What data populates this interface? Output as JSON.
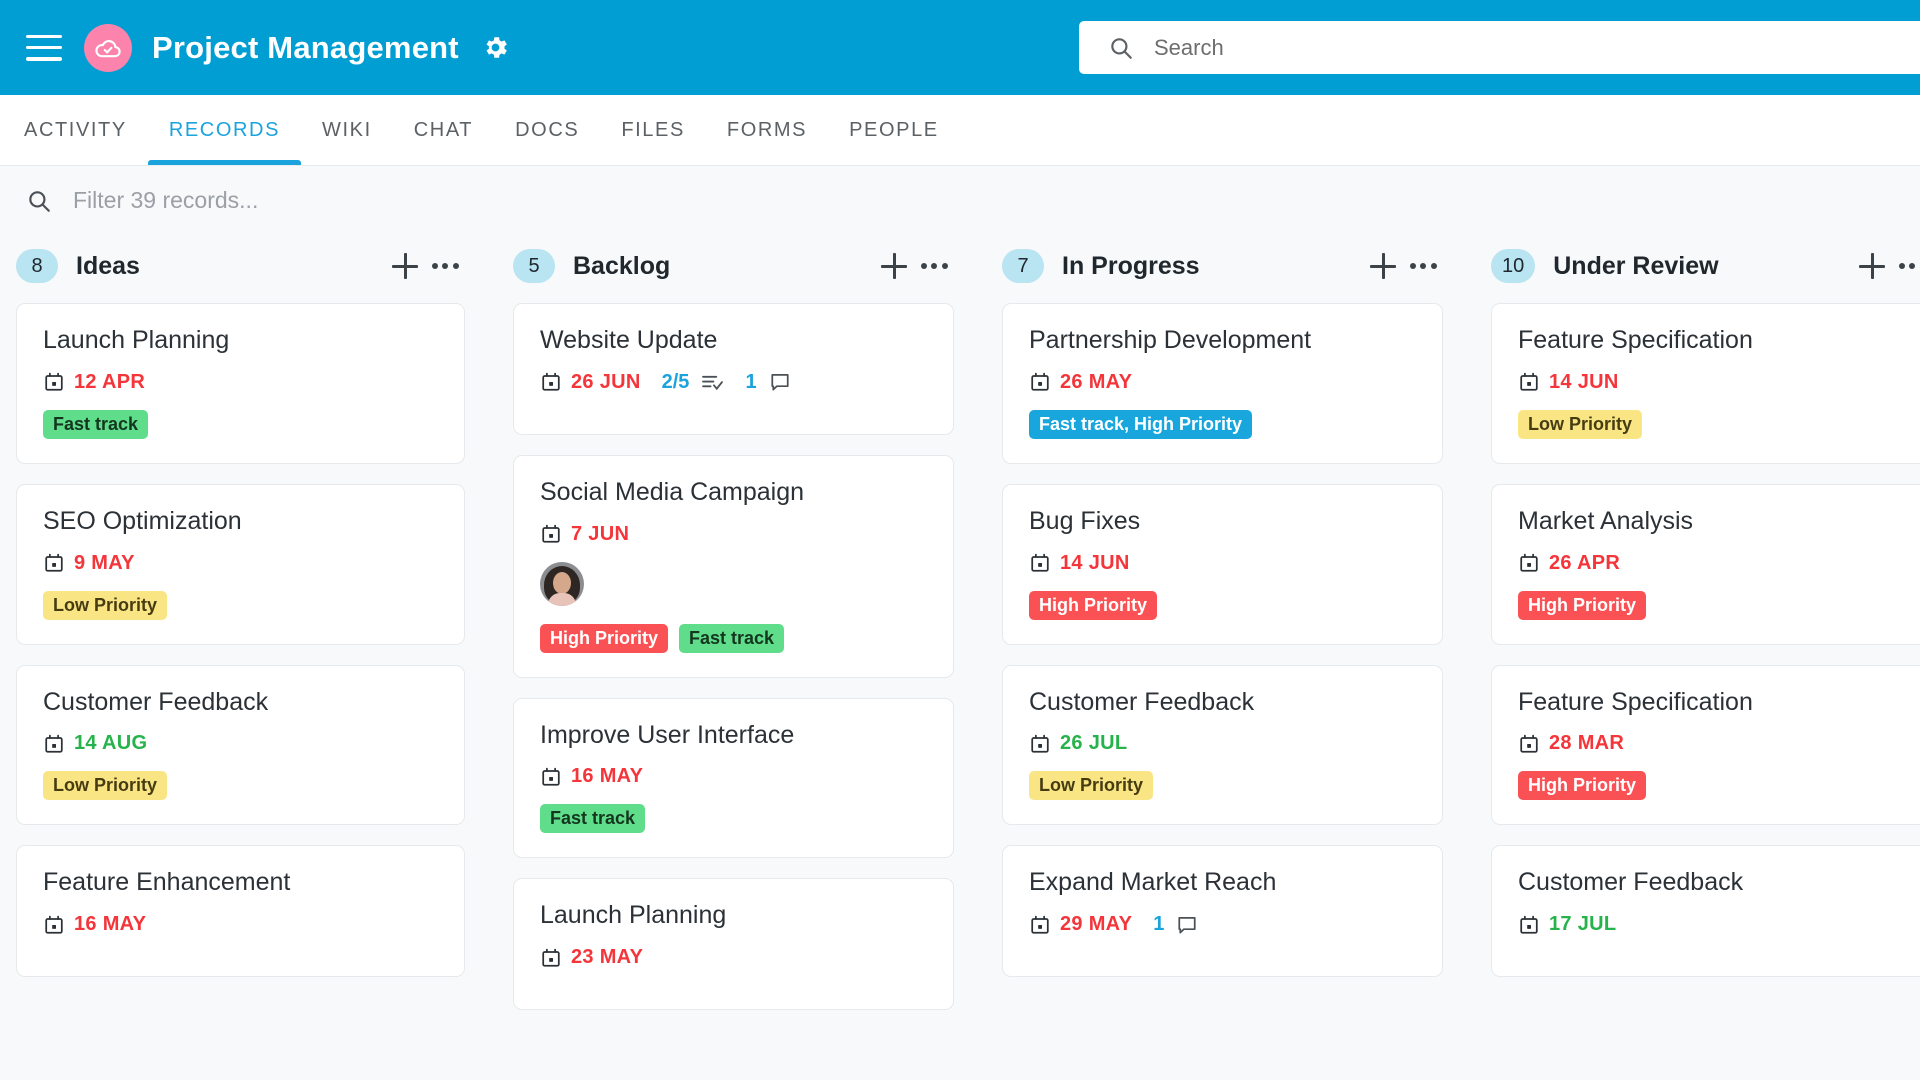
{
  "header": {
    "menu_icon": "hamburger-icon",
    "logo_icon": "cloud-check-icon",
    "title": "Project Management",
    "settings_icon": "gear-icon",
    "search": {
      "icon": "search-icon",
      "value": "",
      "placeholder": "Search"
    },
    "bar_color": "#009ed2",
    "logo_color": "#fb83ac"
  },
  "tabs": [
    {
      "label": "ACTIVITY",
      "active": false
    },
    {
      "label": "RECORDS",
      "active": true
    },
    {
      "label": "WIKI",
      "active": false
    },
    {
      "label": "CHAT",
      "active": false
    },
    {
      "label": "DOCS",
      "active": false
    },
    {
      "label": "FILES",
      "active": false
    },
    {
      "label": "FORMS",
      "active": false
    },
    {
      "label": "PEOPLE",
      "active": false
    }
  ],
  "filter": {
    "icon": "search-icon",
    "value": "",
    "placeholder": "Filter 39 records..."
  },
  "board": {
    "add_icon": "plus-icon",
    "more_icon": "more-options-icon",
    "columns": [
      {
        "count": "8",
        "title": "Ideas",
        "cards": [
          {
            "title": "Launch Planning",
            "due": "12 APR",
            "due_color": "red",
            "checklist": "",
            "comments": "",
            "avatar": false,
            "tags": [
              {
                "label": "Fast track",
                "color": "green"
              }
            ]
          },
          {
            "title": "SEO Optimization",
            "due": "9 MAY",
            "due_color": "red",
            "checklist": "",
            "comments": "",
            "avatar": false,
            "tags": [
              {
                "label": "Low Priority",
                "color": "yellow"
              }
            ]
          },
          {
            "title": "Customer Feedback",
            "due": "14 AUG",
            "due_color": "green",
            "checklist": "",
            "comments": "",
            "avatar": false,
            "tags": [
              {
                "label": "Low Priority",
                "color": "yellow"
              }
            ]
          },
          {
            "title": "Feature Enhancement",
            "due": "16 MAY",
            "due_color": "red",
            "checklist": "",
            "comments": "",
            "avatar": false,
            "tags": []
          }
        ]
      },
      {
        "count": "5",
        "title": "Backlog",
        "cards": [
          {
            "title": "Website Update",
            "due": "26 JUN",
            "due_color": "red",
            "checklist": "2/5",
            "comments": "1",
            "avatar": false,
            "tags": []
          },
          {
            "title": "Social Media Campaign",
            "due": "7 JUN",
            "due_color": "red",
            "checklist": "",
            "comments": "",
            "avatar": true,
            "tags": [
              {
                "label": "High Priority",
                "color": "red"
              },
              {
                "label": "Fast track",
                "color": "green"
              }
            ]
          },
          {
            "title": "Improve User Interface",
            "due": "16 MAY",
            "due_color": "red",
            "checklist": "",
            "comments": "",
            "avatar": false,
            "tags": [
              {
                "label": "Fast track",
                "color": "green"
              }
            ]
          },
          {
            "title": "Launch Planning",
            "due": "23 MAY",
            "due_color": "red",
            "checklist": "",
            "comments": "",
            "avatar": false,
            "tags": []
          }
        ]
      },
      {
        "count": "7",
        "title": "In Progress",
        "cards": [
          {
            "title": "Partnership Development",
            "due": "26 MAY",
            "due_color": "red",
            "checklist": "",
            "comments": "",
            "avatar": false,
            "tags": [
              {
                "label": "Fast track, High Priority",
                "color": "blue"
              }
            ]
          },
          {
            "title": "Bug Fixes",
            "due": "14 JUN",
            "due_color": "red",
            "checklist": "",
            "comments": "",
            "avatar": false,
            "tags": [
              {
                "label": "High Priority",
                "color": "red"
              }
            ]
          },
          {
            "title": "Customer Feedback",
            "due": "26 JUL",
            "due_color": "green",
            "checklist": "",
            "comments": "",
            "avatar": false,
            "tags": [
              {
                "label": "Low Priority",
                "color": "yellow"
              }
            ]
          },
          {
            "title": "Expand Market Reach",
            "due": "29 MAY",
            "due_color": "red",
            "checklist": "",
            "comments": "1",
            "avatar": false,
            "tags": []
          }
        ]
      },
      {
        "count": "10",
        "title": "Under Review",
        "cards": [
          {
            "title": "Feature Specification",
            "due": "14 JUN",
            "due_color": "red",
            "checklist": "",
            "comments": "",
            "avatar": false,
            "tags": [
              {
                "label": "Low Priority",
                "color": "yellow"
              }
            ]
          },
          {
            "title": "Market Analysis",
            "due": "26 APR",
            "due_color": "red",
            "checklist": "",
            "comments": "",
            "avatar": false,
            "tags": [
              {
                "label": "High Priority",
                "color": "red"
              }
            ]
          },
          {
            "title": "Feature Specification",
            "due": "28 MAR",
            "due_color": "red",
            "checklist": "",
            "comments": "",
            "avatar": false,
            "tags": [
              {
                "label": "High Priority",
                "color": "red"
              }
            ]
          },
          {
            "title": "Customer Feedback",
            "due": "17 JUL",
            "due_color": "green",
            "checklist": "",
            "comments": "",
            "avatar": false,
            "tags": []
          }
        ]
      }
    ]
  }
}
